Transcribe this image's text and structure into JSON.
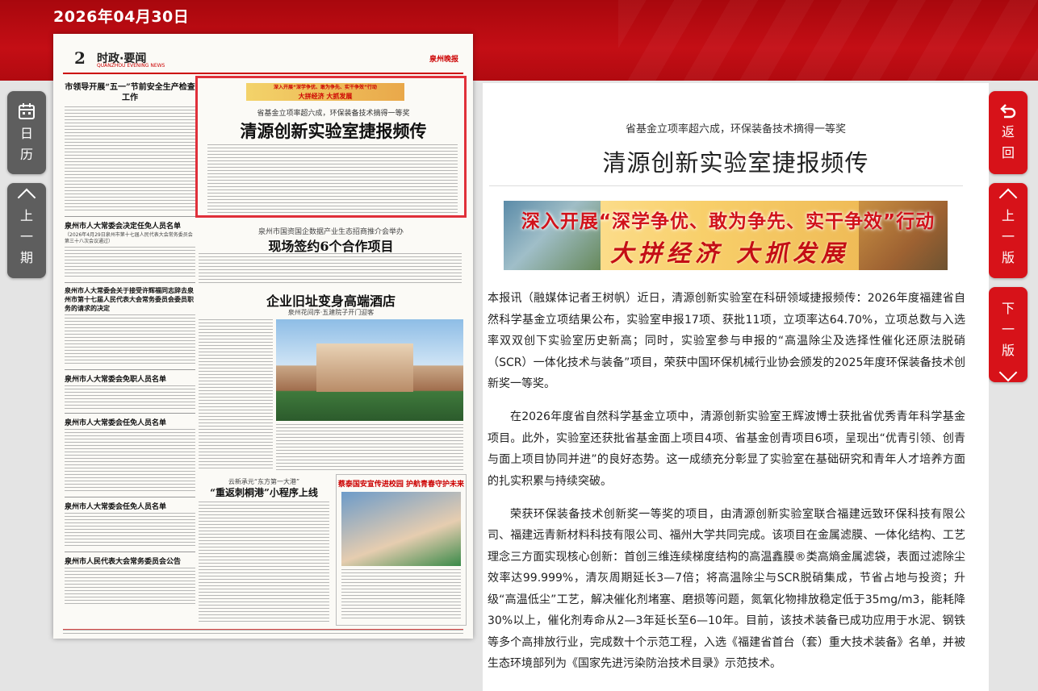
{
  "date": "2026年04月30日",
  "nav": {
    "calendar": [
      "日",
      "历"
    ],
    "prev_issue": [
      "上",
      "一",
      "期"
    ],
    "back": [
      "返",
      "回"
    ],
    "prev_page": [
      "上",
      "一",
      "版"
    ],
    "next_page": [
      "下",
      "一",
      "版"
    ]
  },
  "newspaper": {
    "page_number": "2",
    "section": "时政·要闻",
    "section_en": "QUANZHOU EVENING NEWS",
    "logo": "泉州晚报",
    "left_headlines": [
      "市领导开展“五一”节前安全生产检查工作",
      "泉州市人大常委会决定任免人员名单",
      "泉州市人大常委会关于接受许辉福同志辞去泉州市第十七届人民代表大会常务委员会委员职务的请求的决定",
      "泉州市人大常委会免职人员名单",
      "泉州市人大常委会任免人员名单",
      "泉州市人大常委会任免人员名单",
      "泉州市人民代表大会常务委员会公告"
    ],
    "left_dateline": "（2026年4月29日泉州市第十七届人民代表大会常务委员会第三十八次会议通过）",
    "highlight": {
      "banner_line1": "深入开展“深学争优、敢为争先、实干争效”行动",
      "banner_line2": "大拼经济 大抓发展",
      "subtitle": "省基金立项率超六成，环保装备技术摘得一等奖",
      "title": "清源创新实验室捷报频传"
    },
    "story2": {
      "subtitle": "泉州市国资国企数据产业生态招商推介会举办",
      "title": "现场签约6个合作项目"
    },
    "story3": {
      "title": "企业旧址变身高端酒店",
      "subtitle": "泉州花间序·五建院子开门迎客"
    },
    "story4": {
      "subtitle": "云新承元“东方第一大港”",
      "title": "“重返刺桐港”小程序上线"
    },
    "story5": {
      "title": "蔡泰国安宣传进校园 护航青春守护未来"
    }
  },
  "article": {
    "subtitle": "省基金立项率超六成，环保装备技术摘得一等奖",
    "title": "清源创新实验室捷报频传",
    "banner_line1": "深入开展“深学争优、敢为争先、实干争效”行动",
    "banner_line2": "大拼经济 大抓发展",
    "paragraphs": [
      "本报讯（融媒体记者王树帆）近日，清源创新实验室在科研领域捷报频传：2026年度福建省自然科学基金立项结果公布，实验室申报17项、获批11项，立项率达64.70%，立项总数与入选率双双创下实验室历史新高；同时，实验室参与申报的“高温除尘及选择性催化还原法脱硝（SCR）一体化技术与装备”项目，荣获中国环保机械行业协会颁发的2025年度环保装备技术创新奖一等奖。",
      "在2026年度省自然科学基金立项中，清源创新实验室王辉波博士获批省优秀青年科学基金项目。此外，实验室还获批省基金面上项目4项、省基金创青项目6项，呈现出“优青引领、创青与面上项目协同并进”的良好态势。这一成绩充分彰显了实验室在基础研究和青年人才培养方面的扎实积累与持续突破。",
      "荣获环保装备技术创新奖一等奖的项目，由清源创新实验室联合福建远致环保科技有限公司、福建远青新材料科技有限公司、福州大学共同完成。该项目在金属滤膜、一体化结构、工艺理念三方面实现核心创新：首创三维连续梯度结构的高温鑫膜®类高熵金属滤袋，表面过滤除尘效率达99.999%，清灰周期延长3—7倍；将高温除尘与SCR脱硝集成，节省占地与投资；升级“高温低尘”工艺，解决催化剂堵塞、磨损等问题，氮氧化物排放稳定低于35mg/m3，能耗降30%以上，催化剂寿命从2—3年延长至6—10年。目前，该技术装备已成功应用于水泥、钢铁等多个高排放行业，完成数十个示范工程，入选《福建省首台（套）重大技术装备》名单，并被生态环境部列为《国家先进污染防治技术目录》示范技术。"
    ]
  },
  "colors": {
    "brand_red": "#c40e15",
    "highlight_border": "#e0303a",
    "grey_button": "#5e5e5e"
  }
}
